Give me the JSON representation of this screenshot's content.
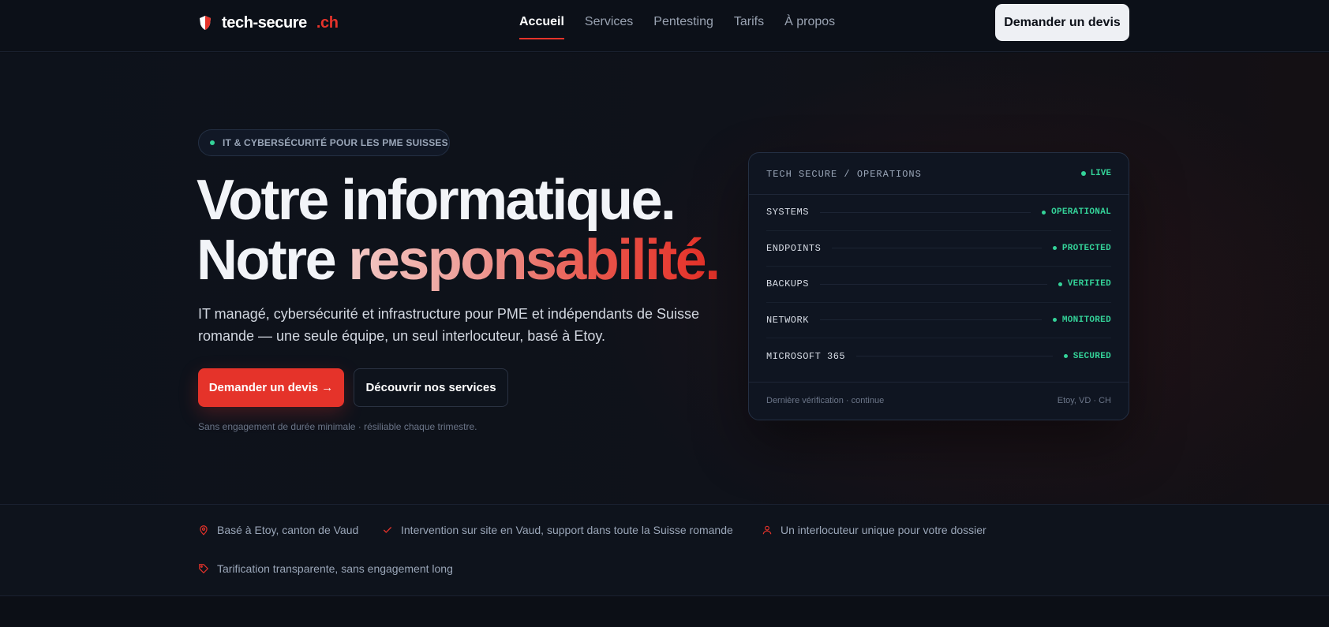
{
  "brand": {
    "name": "tech-secure",
    "tld": ".ch"
  },
  "nav": {
    "links": [
      {
        "label": "Accueil",
        "active": true
      },
      {
        "label": "Services"
      },
      {
        "label": "Pentesting"
      },
      {
        "label": "Tarifs"
      },
      {
        "label": "À propos"
      }
    ],
    "cta": "Demander un devis"
  },
  "hero": {
    "badge": "IT & CYBERSÉCURITÉ POUR LES PME SUISSES",
    "title_line1": "Votre informatique.",
    "title_line2_plain": "Notre ",
    "title_line2_accent": "responsabilité",
    "title_line2_end": ".",
    "lead": "IT managé, cybersécurité et infrastructure pour PME et indépendants de Suisse romande — une seule équipe, un seul interlocuteur, basé à Etoy.",
    "primary_button": "Demander un devis →",
    "secondary_button": "Découvrir nos services",
    "fine_print": "Sans engagement de durée minimale · résiliable chaque trimestre."
  },
  "status_panel": {
    "title": "TECH SECURE / OPERATIONS",
    "live_label": "LIVE",
    "rows": [
      {
        "name": "SYSTEMS",
        "status": "OPERATIONAL"
      },
      {
        "name": "ENDPOINTS",
        "status": "PROTECTED"
      },
      {
        "name": "BACKUPS",
        "status": "VERIFIED"
      },
      {
        "name": "NETWORK",
        "status": "MONITORED"
      },
      {
        "name": "MICROSOFT 365",
        "status": "SECURED"
      }
    ],
    "footer_left": "Dernière vérification · continue",
    "footer_right": "Etoy, VD · CH"
  },
  "trust": [
    {
      "icon": "map-pin-icon",
      "label": "Basé à Etoy, canton de Vaud"
    },
    {
      "icon": "check-icon",
      "label": "Intervention sur site en Vaud, support dans toute la Suisse romande"
    },
    {
      "icon": "user-icon",
      "label": "Un interlocuteur unique pour votre dossier"
    },
    {
      "icon": "tag-icon",
      "label": "Tarification transparente, sans engagement long"
    }
  ],
  "colors": {
    "accent": "#e5332a",
    "status_green": "#34d399",
    "background": "#0b0f17"
  }
}
